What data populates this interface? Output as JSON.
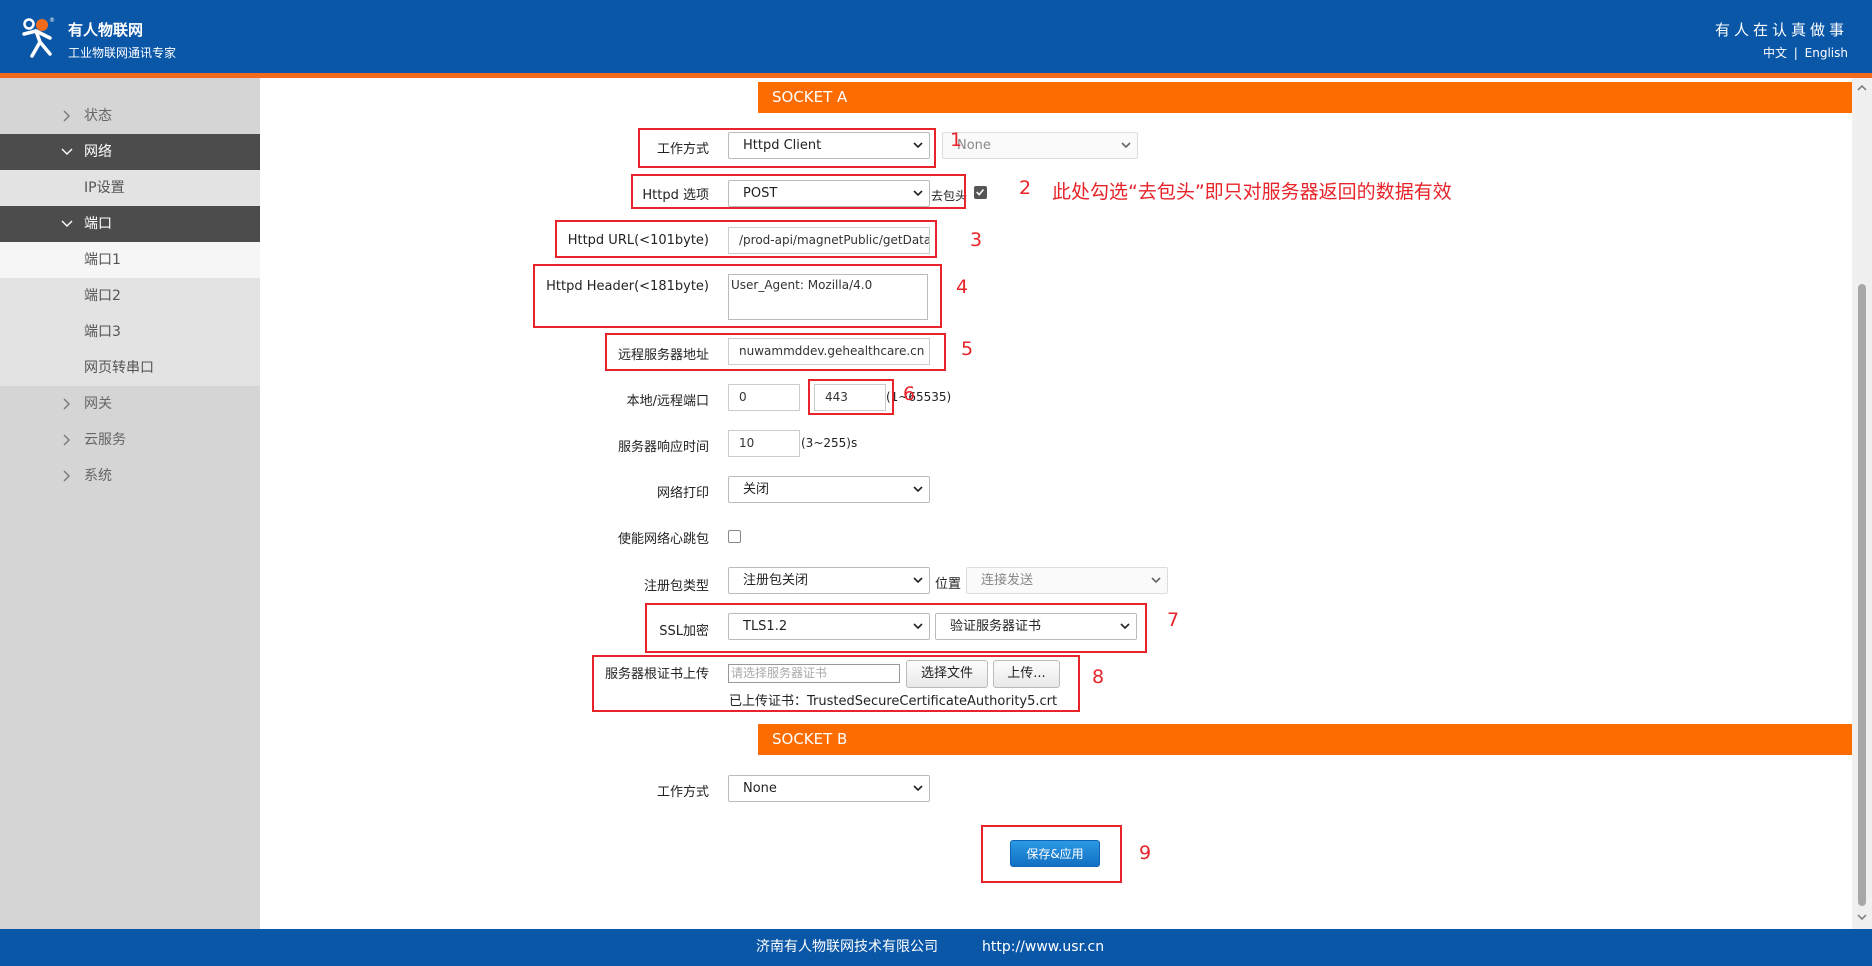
{
  "header": {
    "brand_name": "有人物联网",
    "brand_sub": "工业物联网通讯专家",
    "slogan": "有人在认真做事",
    "lang_zh": "中文",
    "lang_sep": "|",
    "lang_en": "English"
  },
  "sidebar": {
    "items": [
      {
        "label": "状态"
      },
      {
        "label": "网络"
      },
      {
        "label": "IP设置"
      },
      {
        "label": "端口"
      },
      {
        "label": "端口1"
      },
      {
        "label": "端口2"
      },
      {
        "label": "端口3"
      },
      {
        "label": "网页转串口"
      },
      {
        "label": "网关"
      },
      {
        "label": "云服务"
      },
      {
        "label": "系统"
      }
    ]
  },
  "socket_a": {
    "title": "SOCKET A",
    "work_mode": {
      "label": "工作方式",
      "value": "Httpd Client",
      "second_value": "None"
    },
    "httpd_option": {
      "label": "Httpd 选项",
      "value": "POST",
      "strip_header_label": "去包头",
      "strip_header_checked": true
    },
    "httpd_url": {
      "label": "Httpd URL(<101byte)",
      "value": "/prod-api/magnetPublic/getDataF"
    },
    "httpd_header": {
      "label": "Httpd Header(<181byte)",
      "value": "User_Agent: Mozilla/4.0"
    },
    "remote_addr": {
      "label": "远程服务器地址",
      "value": "nuwammddev.gehealthcare.cn"
    },
    "ports": {
      "label": "本地/远程端口",
      "local": "0",
      "remote": "443",
      "range_hint": "(1~65535)"
    },
    "response_time": {
      "label": "服务器响应时间",
      "value": "10",
      "unit": "(3~255)s"
    },
    "net_print": {
      "label": "网络打印",
      "value": "关闭"
    },
    "heartbeat": {
      "label": "使能网络心跳包",
      "checked": false
    },
    "register": {
      "label": "注册包类型",
      "value": "注册包关闭",
      "position_label": "位置",
      "position_value": "连接发送"
    },
    "ssl": {
      "label": "SSL加密",
      "version": "TLS1.2",
      "verify": "验证服务器证书"
    },
    "cert": {
      "label": "服务器根证书上传",
      "placeholder": "请选择服务器证书",
      "choose_label": "选择文件",
      "upload_label": "上传...",
      "uploaded_text": "已上传证书：TrustedSecureCertificateAuthority5.crt"
    }
  },
  "socket_b": {
    "title": "SOCKET B",
    "work_mode": {
      "label": "工作方式",
      "value": "None"
    }
  },
  "save_button": "保存&应用",
  "annotations": {
    "n1": "1",
    "n2": "2",
    "n3": "3",
    "n4": "4",
    "n5": "5",
    "n6": "6",
    "n7": "7",
    "n8": "8",
    "n9": "9",
    "note2": "此处勾选“去包头”即只对服务器返回的数据有效"
  },
  "footer": {
    "company": "济南有人物联网技术有限公司",
    "url": "http://www.usr.cn"
  },
  "colors": {
    "header_bg": "#0a57a8",
    "accent_orange": "#fd6c00",
    "annotation_red": "#e8232a",
    "primary_button": "#1a7fd4"
  }
}
